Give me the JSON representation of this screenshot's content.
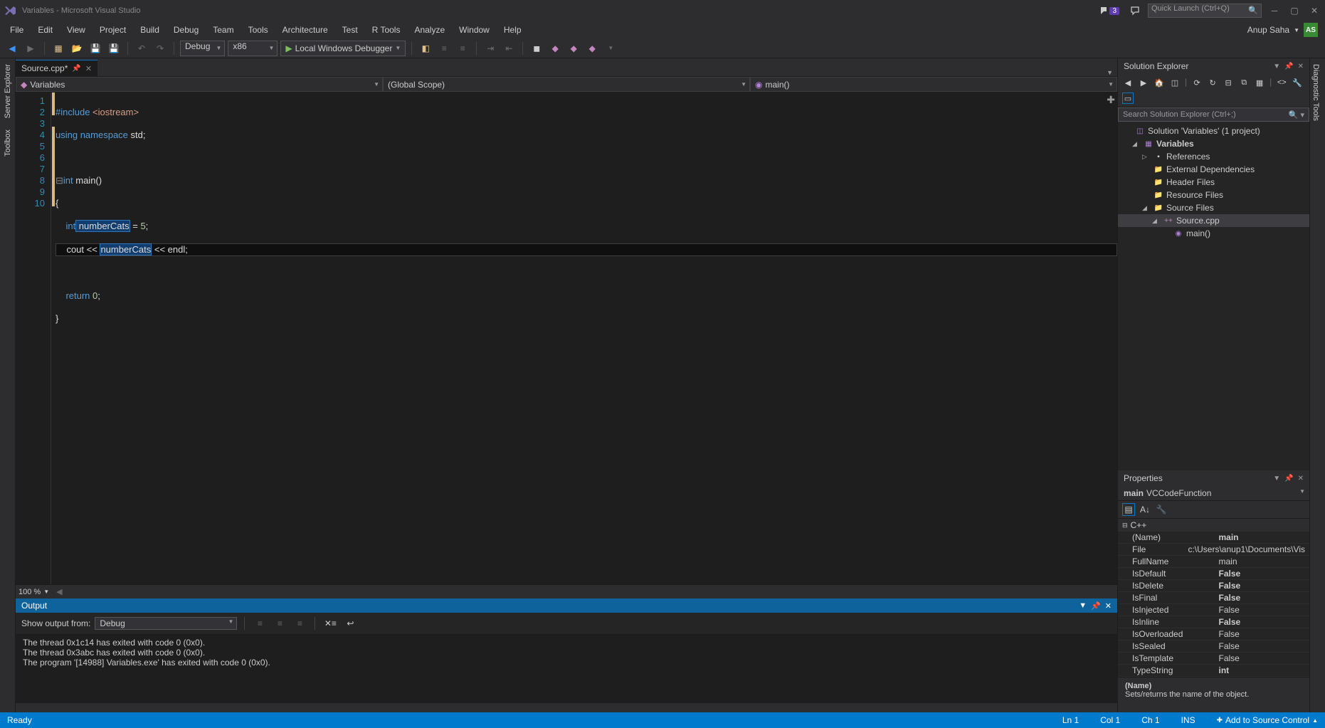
{
  "window": {
    "title": "Variables - Microsoft Visual Studio",
    "notif_count": "3"
  },
  "quicklaunch": {
    "placeholder": "Quick Launch (Ctrl+Q)"
  },
  "menu": [
    "File",
    "Edit",
    "View",
    "Project",
    "Build",
    "Debug",
    "Team",
    "Tools",
    "Architecture",
    "Test",
    "R Tools",
    "Analyze",
    "Window",
    "Help"
  ],
  "user": {
    "name": "Anup Saha",
    "initials": "AS"
  },
  "toolbar": {
    "config": "Debug",
    "platform": "x86",
    "debugger": "Local Windows Debugger"
  },
  "side_left": [
    "Server Explorer",
    "Toolbox"
  ],
  "side_right": "Diagnostic Tools",
  "doc_tab": {
    "name": "Source.cpp*"
  },
  "navbar": {
    "scope_left": "Variables",
    "scope_mid": "(Global Scope)",
    "scope_right": "main()"
  },
  "code": {
    "lines": [
      "1",
      "2",
      "3",
      "4",
      "5",
      "6",
      "7",
      "8",
      "9",
      "10"
    ],
    "l1_a": "#include ",
    "l1_b": "<iostream>",
    "l2_a": "using ",
    "l2_b": "namespace ",
    "l2_c": "std;",
    "l4_a": "int ",
    "l4_b": "main()",
    "l5": "{",
    "l6_a": "    int",
    "l6_b": " numberCats",
    "l6_c": " = ",
    "l6_d": "5",
    "l6_e": ";",
    "l7_a": "    cout << ",
    "l7_b": "numberCats",
    "l7_c": " << endl;",
    "l9_a": "    return ",
    "l9_b": "0",
    "l9_c": ";",
    "l10": "}"
  },
  "zoom": "100 %",
  "output": {
    "title": "Output",
    "from_label": "Show output from:",
    "from_value": "Debug",
    "lines": [
      "The thread 0x1c14 has exited with code 0 (0x0).",
      "The thread 0x3abc has exited with code 0 (0x0).",
      "The program '[14988] Variables.exe' has exited with code 0 (0x0)."
    ]
  },
  "solution_explorer": {
    "title": "Solution Explorer",
    "search_placeholder": "Search Solution Explorer (Ctrl+;)",
    "solution": "Solution 'Variables' (1 project)",
    "project": "Variables",
    "nodes": [
      "References",
      "External Dependencies",
      "Header Files",
      "Resource Files",
      "Source Files"
    ],
    "file": "Source.cpp",
    "func": "main()"
  },
  "properties": {
    "title": "Properties",
    "selected": "main VCCodeFunction",
    "category": "C++",
    "rows": [
      {
        "name": "(Name)",
        "value": "main",
        "bold": true
      },
      {
        "name": "File",
        "value": "c:\\Users\\anup1\\Documents\\Vis",
        "bold": false
      },
      {
        "name": "FullName",
        "value": "main",
        "bold": false
      },
      {
        "name": "IsDefault",
        "value": "False",
        "bold": true
      },
      {
        "name": "IsDelete",
        "value": "False",
        "bold": true
      },
      {
        "name": "IsFinal",
        "value": "False",
        "bold": true
      },
      {
        "name": "IsInjected",
        "value": "False",
        "bold": false
      },
      {
        "name": "IsInline",
        "value": "False",
        "bold": true
      },
      {
        "name": "IsOverloaded",
        "value": "False",
        "bold": false
      },
      {
        "name": "IsSealed",
        "value": "False",
        "bold": false
      },
      {
        "name": "IsTemplate",
        "value": "False",
        "bold": false
      },
      {
        "name": "TypeString",
        "value": "int",
        "bold": true
      }
    ],
    "help_name": "(Name)",
    "help_desc": "Sets/returns the name of the object."
  },
  "status": {
    "ready": "Ready",
    "ln": "Ln 1",
    "col": "Col 1",
    "ch": "Ch 1",
    "ins": "INS",
    "src": "Add to Source Control"
  }
}
